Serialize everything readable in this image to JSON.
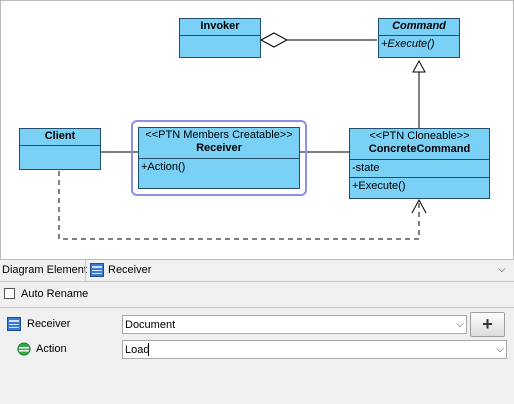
{
  "diagram": {
    "invoker": {
      "name": "Invoker"
    },
    "command": {
      "name": "Command",
      "operations": [
        "+Execute()"
      ]
    },
    "client": {
      "name": "Client"
    },
    "receiver": {
      "stereotype": "<<PTN Members Creatable>>",
      "name": "Receiver",
      "operations": [
        "+Action()"
      ]
    },
    "concrete_command": {
      "stereotype": "<<PTN Cloneable>>",
      "name": "ConcreteCommand",
      "attributes": [
        "-state"
      ],
      "operations": [
        "+Execute()"
      ]
    }
  },
  "properties": {
    "header_label": "Diagram Element",
    "header_value": "Receiver",
    "auto_rename_label": "Auto Rename",
    "auto_rename_checked": false,
    "rows": [
      {
        "label": "Receiver",
        "value": "Document",
        "icon": "class-icon"
      },
      {
        "label": "Action",
        "value": "Load",
        "icon": "operation-icon"
      }
    ],
    "add_label": "+"
  },
  "colors": {
    "class_fill": "#7ad0f5",
    "class_border": "#1f4f6b",
    "selection": "#8f8fea"
  }
}
